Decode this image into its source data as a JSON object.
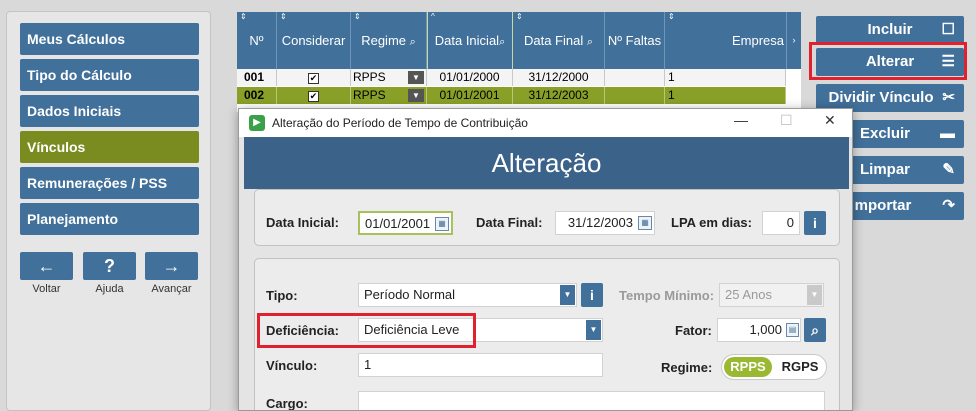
{
  "nav": {
    "items": [
      {
        "label": "Meus Cálculos"
      },
      {
        "label": "Tipo do Cálculo"
      },
      {
        "label": "Dados Iniciais"
      },
      {
        "label": "Vínculos",
        "active": true
      },
      {
        "label": "Remunerações / PSS"
      },
      {
        "label": "Planejamento"
      }
    ],
    "buttons": [
      {
        "icon": "←",
        "label": "Voltar"
      },
      {
        "icon": "?",
        "label": "Ajuda"
      },
      {
        "icon": "→",
        "label": "Avançar"
      }
    ]
  },
  "grid": {
    "columns": [
      "Nº",
      "Considerar",
      "Regime",
      "Data Inicial",
      "Data Final",
      "Nº Faltas",
      "Empresa"
    ],
    "rows": [
      {
        "n": "001",
        "considerar": "✔",
        "regime": "RPPS",
        "data_inicial": "01/01/2000",
        "data_final": "31/12/2000",
        "faltas": "",
        "empresa": "1"
      },
      {
        "n": "002",
        "considerar": "✔",
        "regime": "RPPS",
        "data_inicial": "01/01/2001",
        "data_final": "31/12/2003",
        "faltas": "",
        "empresa": "1"
      }
    ]
  },
  "actions": {
    "incluir": "Incluir",
    "alterar": "Alterar",
    "dividir": "Dividir Vínculo",
    "excluir": "Excluir",
    "limpar": "Limpar",
    "importar": "mportar"
  },
  "dialog": {
    "window_title": "Alteração do Período de Tempo de Contribuição",
    "header": "Alteração",
    "data_inicial_label": "Data Inicial:",
    "data_inicial": "01/01/2001",
    "data_final_label": "Data Final:",
    "data_final": "31/12/2003",
    "lpa_label": "LPA em dias:",
    "lpa": "0",
    "info": "i",
    "tipo_label": "Tipo:",
    "tipo": "Período Normal",
    "tempo_minimo_label": "Tempo Mínimo:",
    "tempo_minimo": "25 Anos",
    "deficiencia_label": "Deficiência:",
    "deficiencia": "Deficiência Leve",
    "fator_label": "Fator:",
    "fator": "1,000",
    "vinculo_label": "Vínculo:",
    "vinculo": "1",
    "regime_label": "Regime:",
    "regime_options": [
      "RPPS",
      "RGPS"
    ],
    "regime_selected": "RPPS",
    "cargo_label": "Cargo:",
    "cargo": ""
  },
  "colors": {
    "primary": "#41709a",
    "active_nav": "#7a8c20",
    "selected_row": "#8a9f27",
    "highlight": "#e0212f",
    "dialog_header": "#3b6288"
  }
}
